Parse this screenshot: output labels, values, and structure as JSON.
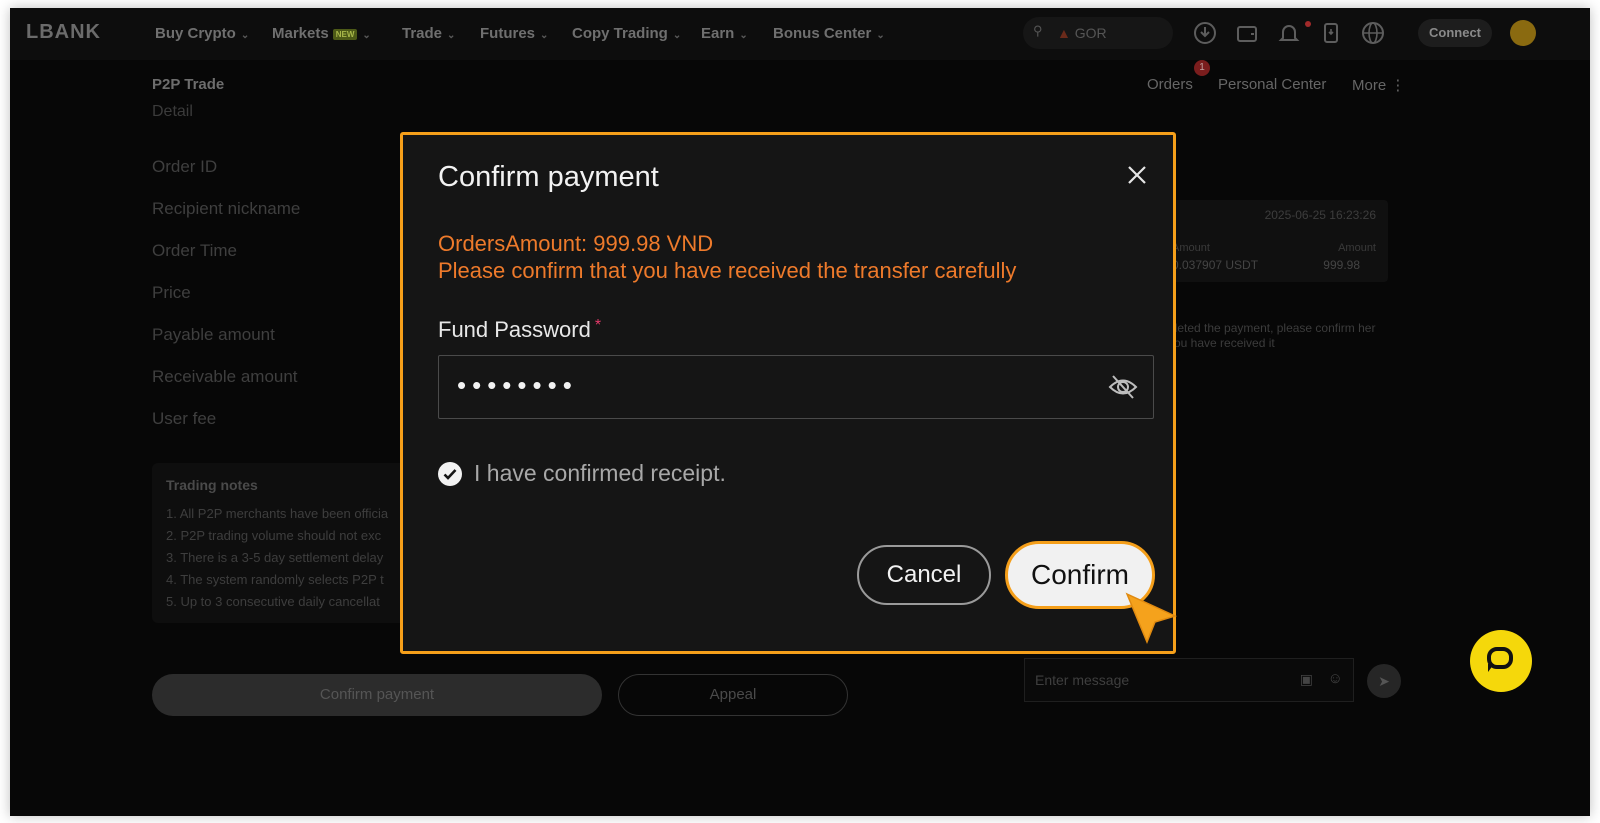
{
  "nav": {
    "logo": "LBANK",
    "items": [
      {
        "label": "Buy Crypto",
        "has_chevron": true
      },
      {
        "label": "Markets",
        "badge": "NEW",
        "has_chevron": true
      },
      {
        "label": "Trade",
        "has_chevron": true
      },
      {
        "label": "Futures",
        "has_chevron": true
      },
      {
        "label": "Copy Trading",
        "has_chevron": true
      },
      {
        "label": "Earn",
        "has_chevron": true
      },
      {
        "label": "Bonus Center",
        "has_chevron": true
      }
    ],
    "search_text": "GOR",
    "icons": [
      "download-icon",
      "wallet-icon",
      "bell-icon",
      "device-icon",
      "globe-icon"
    ],
    "connect_label": "Connect"
  },
  "subheader": {
    "title": "P2P Trade",
    "orders_label": "Orders",
    "orders_count": "1",
    "personal_center_label": "Personal Center",
    "more_label": "More"
  },
  "background": {
    "detail_heading": "Detail",
    "rows": [
      "Order ID",
      "Recipient nickname",
      "Order Time",
      "Price",
      "Payable amount",
      "Receivable amount",
      "User fee"
    ],
    "notes_title": "Trading notes",
    "notes": [
      "1. All P2P merchants have been officia",
      "2. P2P trading volume should not exc",
      "3. There is a 3-5 day settlement delay",
      "4. The system randomly selects P2P t",
      "5. Up to 3 consecutive daily cancellat"
    ],
    "confirm_payment_label": "Confirm payment",
    "appeal_label": "Appeal",
    "chat": {
      "timestamp": "2025-06-25 16:23:26",
      "amount_col_left": "Amount",
      "amount_val_left": "0.037907 USDT",
      "amount_col_right": "Amount",
      "amount_val_right": "999.98",
      "message": "pleted the payment, please confirm her you have received it"
    },
    "message_placeholder": "Enter message"
  },
  "modal": {
    "title": "Confirm payment",
    "orders_amount_line": "OrdersAmount: 999.98 VND",
    "warning_line": "Please confirm that you have received the transfer carefully",
    "fund_password_label": "Fund Password",
    "required_mark": "*",
    "password_mask": "••••••••",
    "receipt_label": "I have confirmed receipt.",
    "receipt_checked": true,
    "cancel_label": "Cancel",
    "confirm_label": "Confirm"
  },
  "colors": {
    "accent_orange": "#f59f1a",
    "warning_text": "#ee7a2b",
    "support_yellow": "#f5d80b"
  }
}
